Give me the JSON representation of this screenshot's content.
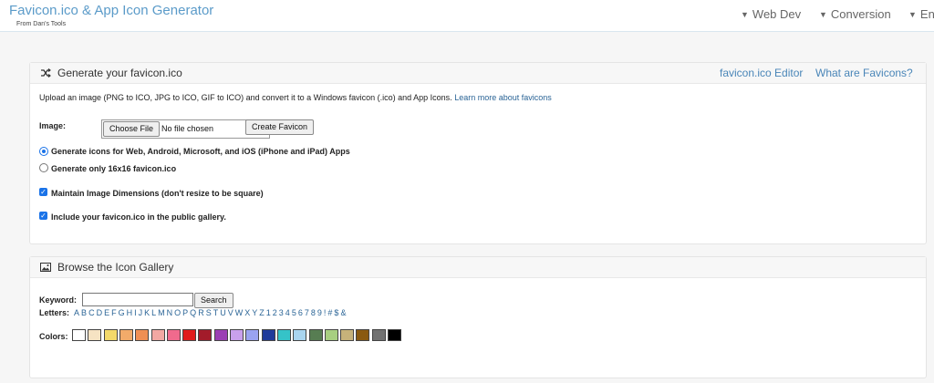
{
  "header": {
    "title": "Favicon.ico & App Icon Generator",
    "subtitle": "From Dan's Tools",
    "nav": [
      "Web Dev",
      "Conversion",
      "Eng"
    ]
  },
  "generate": {
    "title": "Generate your favicon.ico",
    "links": [
      "favicon.ico Editor",
      "What are Favicons?"
    ],
    "intro": "Upload an image (PNG to ICO, JPG to ICO, GIF to ICO) and convert it to a Windows favicon (.ico) and App Icons.",
    "learn_more": "Learn more about favicons",
    "image_label": "Image:",
    "choose_file": "Choose File",
    "no_file": "No file chosen",
    "create_button": "Create Favicon",
    "radio_all": "Generate icons for Web, Android, Microsoft, and iOS (iPhone and iPad) Apps",
    "radio_single": "Generate only 16x16 favicon.ico",
    "check_dimensions": "Maintain Image Dimensions (don't resize to be square)",
    "check_gallery": "Include your favicon.ico in the public gallery."
  },
  "gallery": {
    "title": "Browse the Icon Gallery",
    "keyword_label": "Keyword:",
    "search_button": "Search",
    "letters_label": "Letters:",
    "letters": [
      "A",
      "B",
      "C",
      "D",
      "E",
      "F",
      "G",
      "H",
      "I",
      "J",
      "K",
      "L",
      "M",
      "N",
      "O",
      "P",
      "Q",
      "R",
      "S",
      "T",
      "U",
      "V",
      "W",
      "X",
      "Y",
      "Z",
      "1",
      "2",
      "3",
      "4",
      "5",
      "6",
      "7",
      "8",
      "9",
      "!",
      "#",
      "$",
      "&"
    ],
    "colors_label": "Colors:",
    "colors": [
      "#ffffff",
      "#f6e3c3",
      "#f3d96a",
      "#f2ab6a",
      "#ef8f54",
      "#f3a8a3",
      "#f06a8d",
      "#e01b1b",
      "#a31b2a",
      "#9b3fb4",
      "#c9a0ec",
      "#9aa3f0",
      "#1f3a9a",
      "#35c3c8",
      "#a9d4ef",
      "#577d52",
      "#a7cf80",
      "#c7b27a",
      "#8a5a10",
      "#727272",
      "#000000"
    ]
  }
}
